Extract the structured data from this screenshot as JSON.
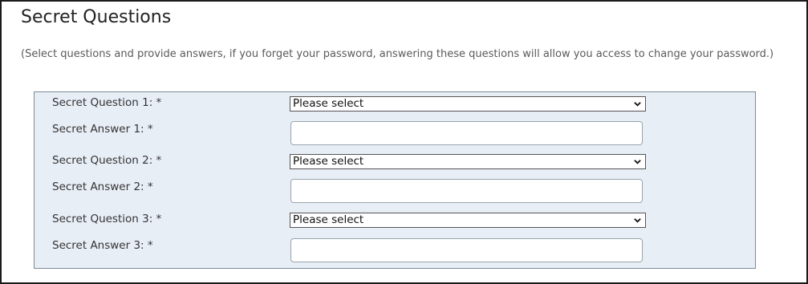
{
  "section": {
    "title": "Secret Questions",
    "description": "(Select questions and provide answers, if you forget your password, answering these questions will allow you access to change your password.)"
  },
  "fields": [
    {
      "label": "Secret Question 1: *",
      "selected": "Please select",
      "chevron_icon": "chevron-down-icon"
    },
    {
      "label": "Secret Answer 1: *",
      "value": ""
    },
    {
      "label": "Secret Question 2: *",
      "selected": "Please select",
      "chevron_icon": "chevron-down-icon"
    },
    {
      "label": "Secret Answer 2: *",
      "value": ""
    },
    {
      "label": "Secret Question 3: *",
      "selected": "Please select",
      "chevron_icon": "chevron-down-icon"
    },
    {
      "label": "Secret Answer 3: *",
      "value": ""
    }
  ],
  "colors": {
    "panel_background": "#e8eef6",
    "panel_border": "#7f8a96",
    "title_text": "#222222",
    "description_text": "#5a5a5a"
  }
}
